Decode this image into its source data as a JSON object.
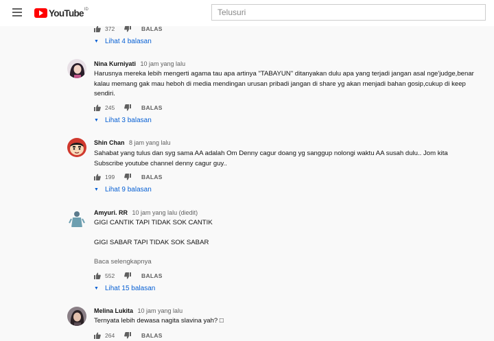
{
  "header": {
    "brand": "YouTube",
    "country": "ID",
    "search_placeholder": "Telusuri"
  },
  "top_partial": {
    "likes": "372",
    "reply_label": "BALAS",
    "view_replies": "Lihat 4 balasan"
  },
  "comments": [
    {
      "author": "Nina Kurniyati",
      "time": "10 jam yang lalu",
      "text": "Harusnya mereka lebih mengerti agama tau apa artinya \"TABAYUN\" ditanyakan dulu apa yang terjadi jangan asal nge'judge,benar kalau memang gak mau heboh di media mendingan urusan pribadi jangan di share yg akan menjadi bahan gosip,cukup di keep sendiri.",
      "likes": "245",
      "reply_label": "BALAS",
      "view_replies": "Lihat 3 balasan"
    },
    {
      "author": "Shin Chan",
      "time": "8 jam yang lalu",
      "text": "Sahabat yang tulus dan syg sama AA adalah Om Denny cagur doang yg sanggup  nolongi waktu AA susah dulu.. Jom kita Subscribe youtube channel denny cagur guy..",
      "likes": "199",
      "reply_label": "BALAS",
      "view_replies": "Lihat 9 balasan"
    },
    {
      "author": "Amyuri. RR",
      "time": "10 jam yang lalu (diedit)",
      "line1": "GIGI CANTIK TAPI TIDAK SOK CANTIK",
      "line2": "GIGI SABAR TAPI TIDAK SOK SABAR",
      "read_more": "Baca selengkapnya",
      "likes": "552",
      "reply_label": "BALAS",
      "view_replies": "Lihat 15 balasan"
    },
    {
      "author": "Melina Lukita",
      "time": "10 jam yang lalu",
      "text": "Ternyata lebih dewasa nagita slavina yah? □",
      "likes": "264",
      "reply_label": "BALAS"
    }
  ]
}
